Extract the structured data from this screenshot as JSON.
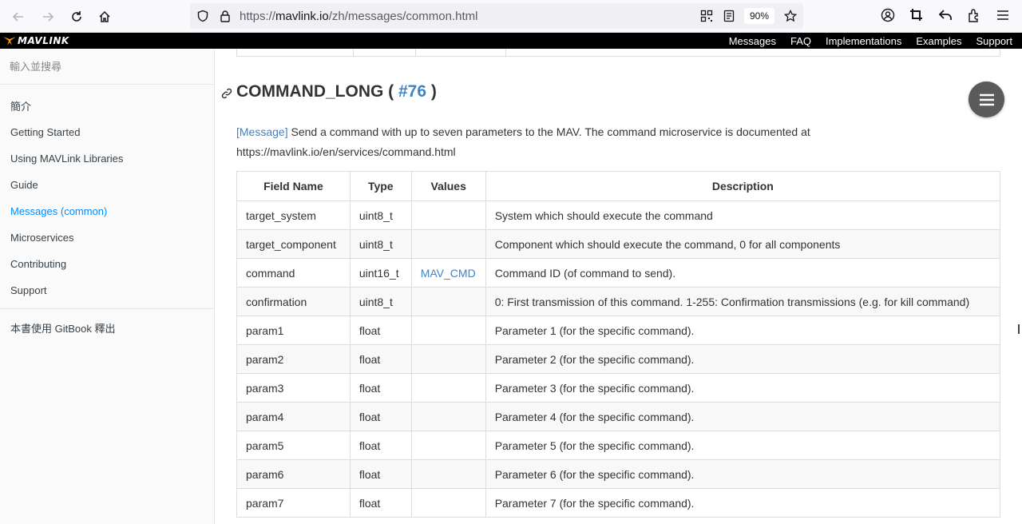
{
  "browser": {
    "url_prefix": "https://",
    "url_domain": "mavlink.io",
    "url_path": "/zh/messages/common.html",
    "zoom": "90%"
  },
  "site": {
    "logo_text": "MAVLINK",
    "nav": [
      "Messages",
      "FAQ",
      "Implementations",
      "Examples",
      "Support"
    ]
  },
  "sidebar": {
    "search_placeholder": "輸入並搜尋",
    "items": [
      {
        "label": "簡介",
        "active": false
      },
      {
        "label": "Getting Started",
        "active": false
      },
      {
        "label": "Using MAVLink Libraries",
        "active": false
      },
      {
        "label": "Guide",
        "active": false
      },
      {
        "label": "Messages (common)",
        "active": true
      },
      {
        "label": "Microservices",
        "active": false
      },
      {
        "label": "Contributing",
        "active": false
      },
      {
        "label": "Support",
        "active": false
      }
    ],
    "gitbook_label": "本書使用 GitBook 釋出"
  },
  "message": {
    "name": "COMMAND_LONG",
    "open_paren": " ( ",
    "id": "#76",
    "close_paren": " )",
    "tag": "[Message]",
    "description": " Send a command with up to seven parameters to the MAV. The command microservice is documented at https://mavlink.io/en/services/command.html",
    "columns": [
      "Field Name",
      "Type",
      "Values",
      "Description"
    ],
    "rows": [
      {
        "field": "target_system",
        "type": "uint8_t",
        "values": "",
        "description": "System which should execute the command"
      },
      {
        "field": "target_component",
        "type": "uint8_t",
        "values": "",
        "description": "Component which should execute the command, 0 for all components"
      },
      {
        "field": "command",
        "type": "uint16_t",
        "values": "MAV_CMD",
        "description": "Command ID (of command to send)."
      },
      {
        "field": "confirmation",
        "type": "uint8_t",
        "values": "",
        "description": "0: First transmission of this command. 1-255: Confirmation transmissions (e.g. for kill command)"
      },
      {
        "field": "param1",
        "type": "float",
        "values": "",
        "description": "Parameter 1 (for the specific command)."
      },
      {
        "field": "param2",
        "type": "float",
        "values": "",
        "description": "Parameter 2 (for the specific command)."
      },
      {
        "field": "param3",
        "type": "float",
        "values": "",
        "description": "Parameter 3 (for the specific command)."
      },
      {
        "field": "param4",
        "type": "float",
        "values": "",
        "description": "Parameter 4 (for the specific command)."
      },
      {
        "field": "param5",
        "type": "float",
        "values": "",
        "description": "Parameter 5 (for the specific command)."
      },
      {
        "field": "param6",
        "type": "float",
        "values": "",
        "description": "Parameter 6 (for the specific command)."
      },
      {
        "field": "param7",
        "type": "float",
        "values": "",
        "description": "Parameter 7 (for the specific command)."
      }
    ]
  },
  "colors": {
    "link": "#4183c4",
    "active_nav": "#008cff",
    "header_bg": "#000000",
    "logo_orange": "#f7941d"
  }
}
